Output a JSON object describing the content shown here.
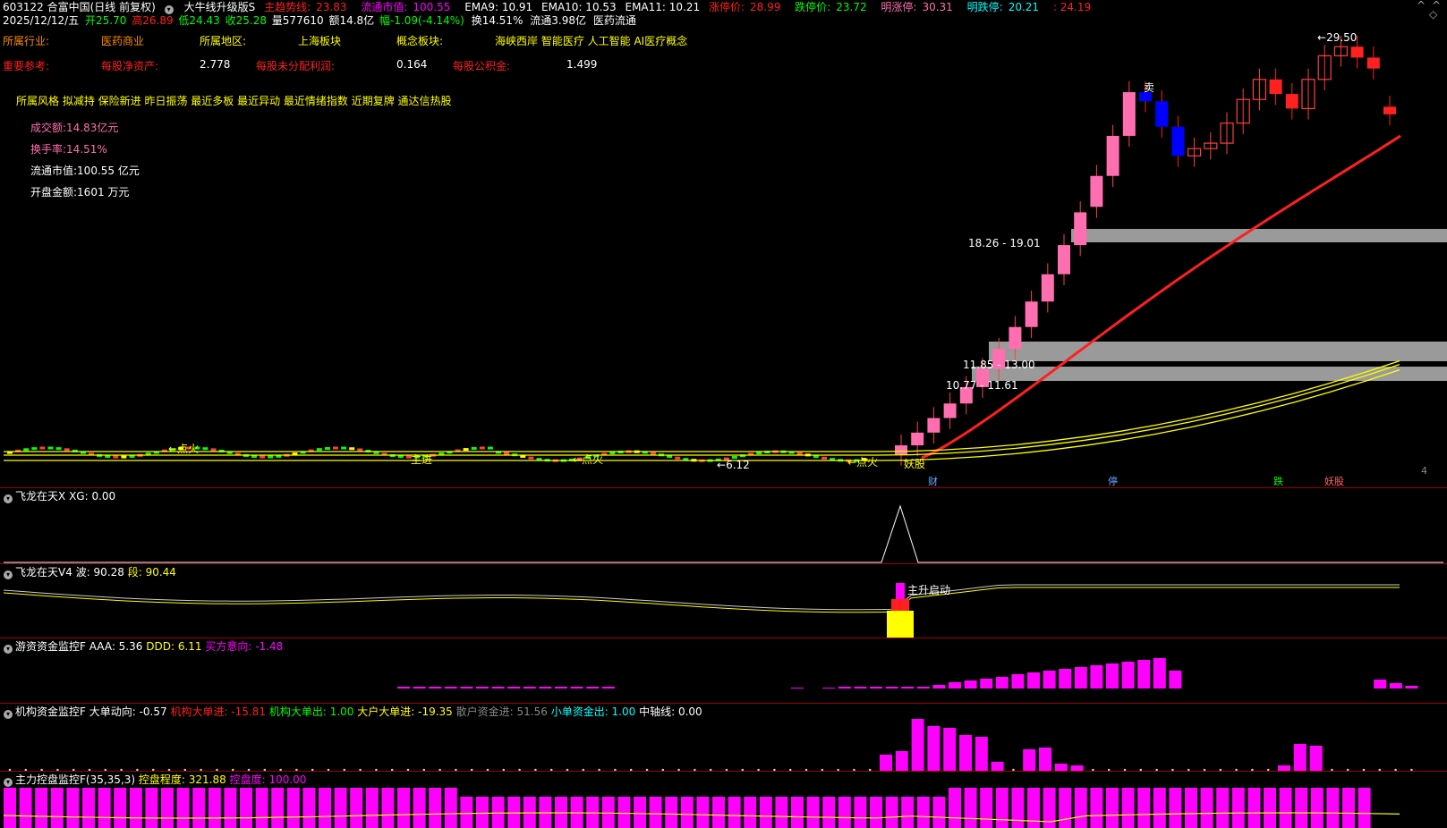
{
  "header": {
    "code_name": "603122 合富中国(日线 前复权)",
    "indicator_name": "大牛线升级版S",
    "main_trend_label": "主趋势线:",
    "main_trend_value": "23.83",
    "float_mv_label": "流通市值:",
    "float_mv_value": "100.55",
    "ema9": "EMA9: 10.91",
    "ema10": "EMA10: 10.53",
    "ema11": "EMA11: 10.21",
    "limit_up_label": "涨停价:",
    "limit_up_value": "28.99",
    "limit_down_label": "跌停价:",
    "limit_down_value": "23.72",
    "next_up_label": "明涨停:",
    "next_up_value": "30.31",
    "next_down_label": "明跌停:",
    "next_down_value": "20.21",
    "extra_value": ": 24.19"
  },
  "quote": {
    "date": "2025/12/12/五",
    "open": "开25.70",
    "high": "高26.89",
    "low": "低24.43",
    "close": "收25.28",
    "volume": "量577610",
    "amount": "额14.8亿",
    "change": "幅-1.09(-4.14%)",
    "turnover": "换14.51%",
    "float": "流通3.98亿",
    "sector": "医药流通"
  },
  "info": {
    "industry_label": "所属行业:",
    "industry": "医药商业",
    "region_label": "所属地区:",
    "region": "上海板块",
    "concept_label": "概念板块:",
    "concept": "海峡西岸 智能医疗 人工智能 AI医疗概念",
    "ref_label": "重要参考:",
    "nav_label": "每股净资产:",
    "nav": "2.778",
    "undist_label": "每股未分配利润:",
    "undist": "0.164",
    "reserve_label": "每股公积金:",
    "reserve": "1.499",
    "tags": "所属风格 拟减持 保险新进 昨日振荡 最近多板 最近异动 最近情绪指数 近期复牌 通达信热股",
    "amount_line": "成交额:14.83亿元",
    "turnover_line": "换手率:14.51%",
    "float_line": "流通市值:100.55 亿元",
    "open_amt_line": "开盘金额:1601 万元"
  },
  "chart_annotations": {
    "max_price": "29.50",
    "min_price": "6.12",
    "zone_high": "18.26 - 19.01",
    "zone_mid": "11.85 - 13.00",
    "zone_low": "10.77 - 11.61",
    "sell": "卖",
    "buy_dot": "点火",
    "buy_dot2": "点火",
    "buy_dot3": "点火",
    "mainforce": "主进",
    "yao": "妖股",
    "cai": "财",
    "ting": "停",
    "bottom_right1": "跌",
    "bottom_right2": "妖股",
    "bottom_right3": "4",
    "main_start": "主升启动"
  },
  "panels": {
    "p1_title": "飞龙在天X",
    "p1_val": "XG: 0.00",
    "p2_title": "飞龙在天V4",
    "p2_wave": "波: 90.28",
    "p2_seg": "段: 90.44",
    "p3_title": "游资资金监控F",
    "p3_aaa": "AAA: 5.36",
    "p3_ddd": "DDD: 6.11",
    "p3_buy": "买方意向: -1.48",
    "p4_title": "机构资金监控F",
    "p4_big": "大单动向: -0.57",
    "p4_in": "机构大单进: -15.81",
    "p4_out": "机构大单出: 1.00",
    "p4_big_in": "大户大单进: -19.35",
    "p4_retail_in": "散户资金进: 51.56",
    "p4_small_out": "小单资金出: 1.00",
    "p4_axis": "中轴线: 0.00",
    "p5_title": "主力控盘监控F(35,35,3)",
    "p5_degree": "控盘程度: 321.88",
    "p5_ctrl": "控盘度: 100.00"
  },
  "colors": {
    "up": "#ff6fb0",
    "down": "#00ff00",
    "red": "#ff2020",
    "magenta": "#ff00ff",
    "yellow": "#ffff00"
  },
  "chart_data": {
    "type": "candlestick",
    "title": "603122 合富中国(日线 前复权)",
    "candles_recent": [
      {
        "o": 6.6,
        "c": 7.1
      },
      {
        "o": 7.1,
        "c": 7.8
      },
      {
        "o": 7.8,
        "c": 8.6
      },
      {
        "o": 8.6,
        "c": 9.4
      },
      {
        "o": 9.4,
        "c": 10.3
      },
      {
        "o": 10.3,
        "c": 11.3
      },
      {
        "o": 11.3,
        "c": 12.4
      },
      {
        "o": 12.4,
        "c": 13.6
      },
      {
        "o": 13.6,
        "c": 15.0
      },
      {
        "o": 15.0,
        "c": 16.5
      },
      {
        "o": 16.5,
        "c": 18.1
      },
      {
        "o": 18.1,
        "c": 19.9
      },
      {
        "o": 20.2,
        "c": 21.9
      },
      {
        "o": 21.9,
        "c": 24.1
      },
      {
        "o": 24.1,
        "c": 26.5
      },
      {
        "o": 26.5,
        "c": 26.0
      },
      {
        "o": 26.0,
        "c": 24.6
      },
      {
        "o": 24.6,
        "c": 23.0
      },
      {
        "o": 23.0,
        "c": 23.4
      },
      {
        "o": 23.4,
        "c": 23.7
      },
      {
        "o": 23.7,
        "c": 24.8
      },
      {
        "o": 24.8,
        "c": 26.1
      },
      {
        "o": 26.1,
        "c": 27.2
      },
      {
        "o": 27.2,
        "c": 26.4
      },
      {
        "o": 26.4,
        "c": 25.6
      },
      {
        "o": 25.6,
        "c": 27.2
      },
      {
        "o": 27.2,
        "c": 28.5
      },
      {
        "o": 28.5,
        "c": 29.0
      },
      {
        "o": 29.0,
        "c": 28.4
      },
      {
        "o": 28.4,
        "c": 27.8
      },
      {
        "o": 25.7,
        "c": 25.28
      }
    ],
    "trend_line": "red",
    "ylim": [
      6.12,
      29.5
    ]
  }
}
